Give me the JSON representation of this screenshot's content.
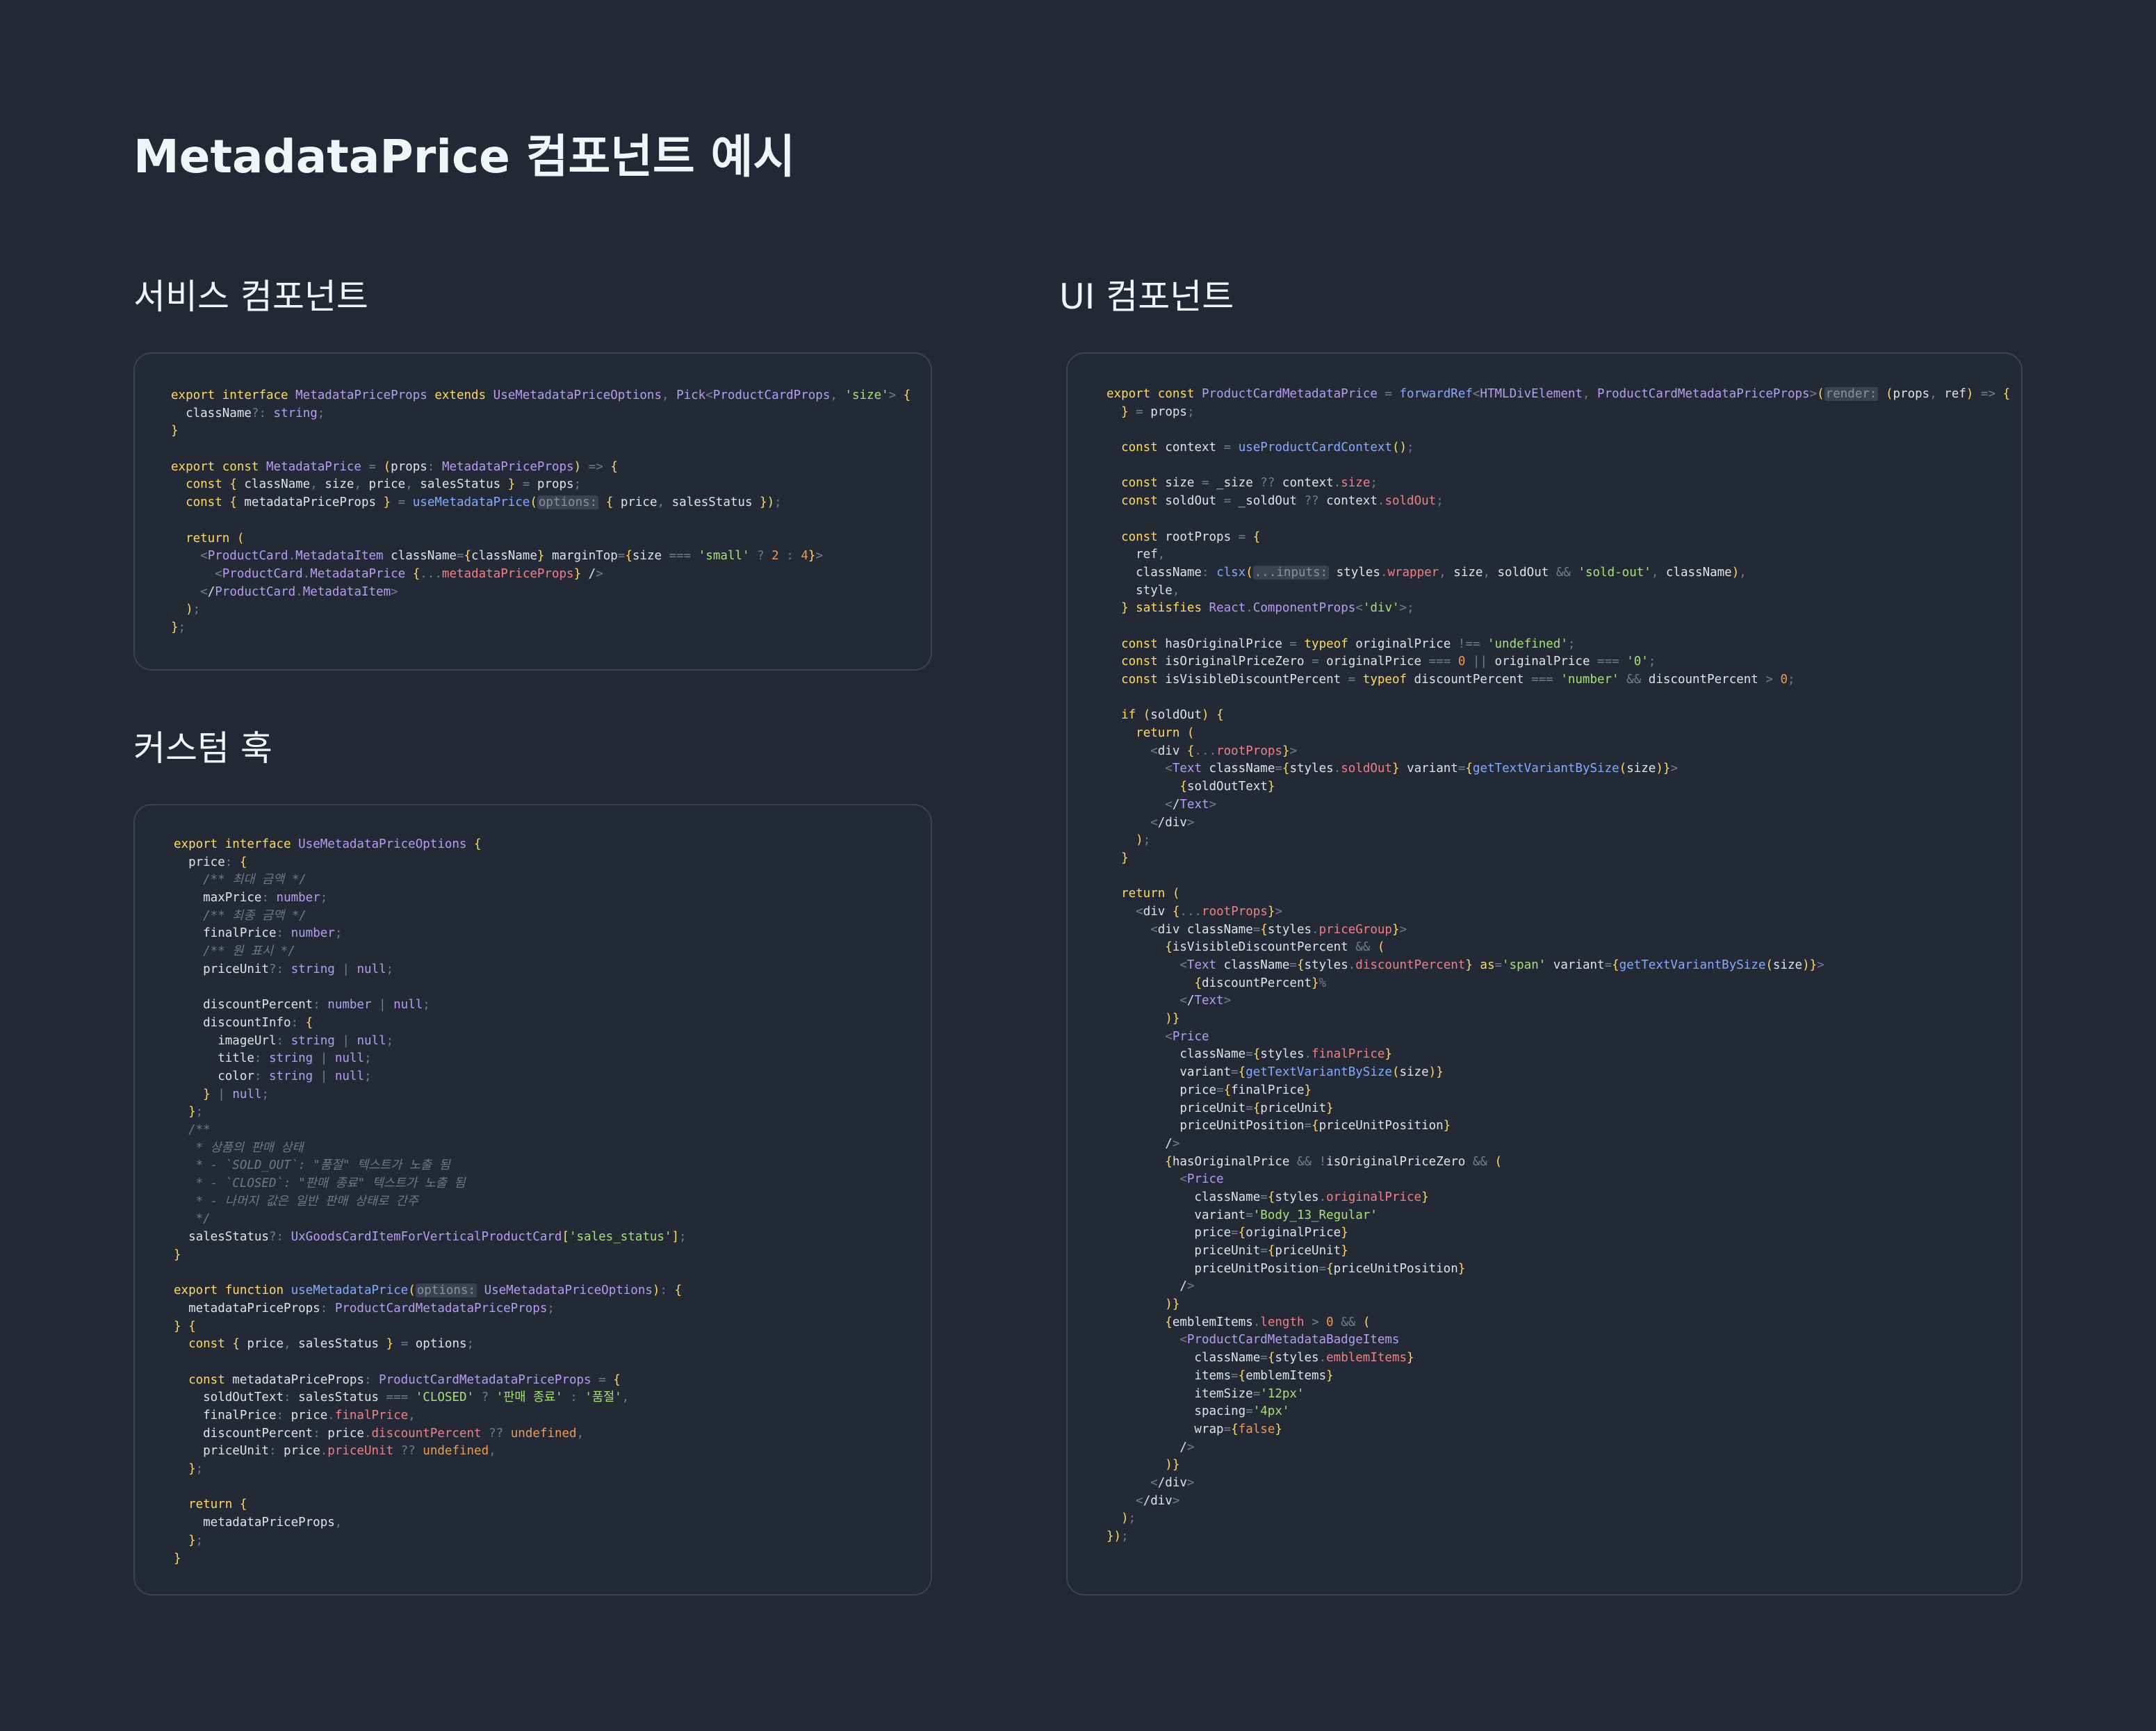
{
  "page": {
    "title": "MetadataPrice 컴포넌트 예시"
  },
  "sections": {
    "service": {
      "title": "서비스 컴포넌트"
    },
    "hook": {
      "title": "커스텀 훅"
    },
    "ui": {
      "title": "UI 컴포넌트"
    }
  },
  "code": {
    "service": [
      "export interface MetadataPriceProps extends UseMetadataPriceOptions, Pick<ProductCardProps, 'size'> {",
      "  className?: string;",
      "}",
      "",
      "export const MetadataPrice = (props: MetadataPriceProps) => {",
      "  const { className, size, price, salesStatus } = props;",
      "  const { metadataPriceProps } = useMetadataPrice(options: { price, salesStatus });",
      "",
      "  return (",
      "    <ProductCard.MetadataItem className={className} marginTop={size === 'small' ? 2 : 4}>",
      "      <ProductCard.MetadataPrice {...metadataPriceProps} />",
      "    </ProductCard.MetadataItem>",
      "  );",
      "};"
    ],
    "hook": [
      "export interface UseMetadataPriceOptions {",
      "  price: {",
      "    /** 최대 금액 */",
      "    maxPrice: number;",
      "    /** 최종 금액 */",
      "    finalPrice: number;",
      "    /** 원 표시 */",
      "    priceUnit?: string | null;",
      "",
      "    discountPercent: number | null;",
      "    discountInfo: {",
      "      imageUrl: string | null;",
      "      title: string | null;",
      "      color: string | null;",
      "    } | null;",
      "  };",
      "  /**",
      "   * 상품의 판매 상태",
      "   * - `SOLD_OUT`: \"품절\" 텍스트가 노출 됨",
      "   * - `CLOSED`: \"판매 종료\" 텍스트가 노출 됨",
      "   * - 나머지 값은 일반 판매 상태로 간주",
      "   */",
      "  salesStatus?: UxGoodsCardItemForVerticalProductCard['sales_status'];",
      "}",
      "",
      "export function useMetadataPrice(options: UseMetadataPriceOptions): {",
      "  metadataPriceProps: ProductCardMetadataPriceProps;",
      "} {",
      "  const { price, salesStatus } = options;",
      "",
      "  const metadataPriceProps: ProductCardMetadataPriceProps = {",
      "    soldOutText: salesStatus === 'CLOSED' ? '판매 종료' : '품절',",
      "    finalPrice: price.finalPrice,",
      "    discountPercent: price.discountPercent ?? undefined,",
      "    priceUnit: price.priceUnit ?? undefined,",
      "  };",
      "",
      "  return {",
      "    metadataPriceProps,",
      "  };",
      "}"
    ],
    "ui": [
      "export const ProductCardMetadataPrice = forwardRef<HTMLDivElement, ProductCardMetadataPriceProps>(render: (props, ref) => {",
      "  } = props;",
      "",
      "  const context = useProductCardContext();",
      "",
      "  const size = _size ?? context.size;",
      "  const soldOut = _soldOut ?? context.soldOut;",
      "",
      "  const rootProps = {",
      "    ref,",
      "    className: clsx(...inputs: styles.wrapper, size, soldOut && 'sold-out', className),",
      "    style,",
      "  } satisfies React.ComponentProps<'div'>;",
      "",
      "  const hasOriginalPrice = typeof originalPrice !== 'undefined';",
      "  const isOriginalPriceZero = originalPrice === 0 || originalPrice === '0';",
      "  const isVisibleDiscountPercent = typeof discountPercent === 'number' && discountPercent > 0;",
      "",
      "  if (soldOut) {",
      "    return (",
      "      <div {...rootProps}>",
      "        <Text className={styles.soldOut} variant={getTextVariantBySize(size)}>",
      "          {soldOutText}",
      "        </Text>",
      "      </div>",
      "    );",
      "  }",
      "",
      "  return (",
      "    <div {...rootProps}>",
      "      <div className={styles.priceGroup}>",
      "        {isVisibleDiscountPercent && (",
      "          <Text className={styles.discountPercent} as='span' variant={getTextVariantBySize(size)}>",
      "            {discountPercent}%",
      "          </Text>",
      "        )}",
      "        <Price",
      "          className={styles.finalPrice}",
      "          variant={getTextVariantBySize(size)}",
      "          price={finalPrice}",
      "          priceUnit={priceUnit}",
      "          priceUnitPosition={priceUnitPosition}",
      "        />",
      "        {hasOriginalPrice && !isOriginalPriceZero && (",
      "          <Price",
      "            className={styles.originalPrice}",
      "            variant='Body_13_Regular'",
      "            price={originalPrice}",
      "            priceUnit={priceUnit}",
      "            priceUnitPosition={priceUnitPosition}",
      "          />",
      "        )}",
      "        {emblemItems.length > 0 && (",
      "          <ProductCardMetadataBadgeItems",
      "            className={styles.emblemItems}",
      "            items={emblemItems}",
      "            itemSize='12px'",
      "            spacing='4px'",
      "            wrap={false}",
      "          />",
      "        )}",
      "      </div>",
      "    </div>",
      "  );",
      "});"
    ]
  }
}
